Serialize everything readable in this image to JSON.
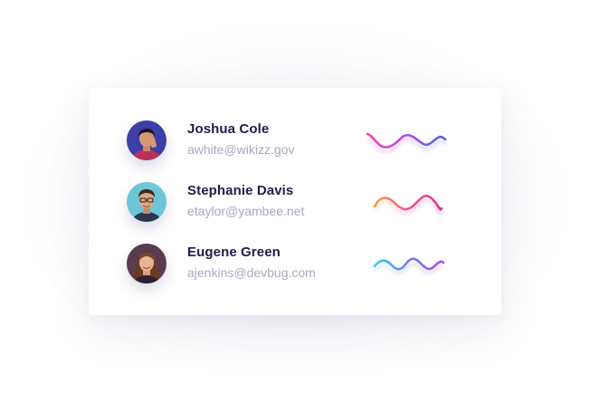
{
  "contacts": [
    {
      "name": "Joshua Cole",
      "email": "awhite@wikizz.gov",
      "avatar_icon": "person-avatar-icon",
      "avatar_bg": "#3b3fa6",
      "wave_gradient": [
        "#ff3fb4",
        "#b04bf0",
        "#4a63f0"
      ]
    },
    {
      "name": "Stephanie Davis",
      "email": "etaylor@yambee.net",
      "avatar_icon": "person-avatar-icon",
      "avatar_bg": "#6cc6d8",
      "wave_gradient": [
        "#ff9a3c",
        "#ff4f8a",
        "#e0308a"
      ]
    },
    {
      "name": "Eugene Green",
      "email": "ajenkins@devbug.com",
      "avatar_icon": "person-avatar-icon",
      "avatar_bg": "#5a3a4e",
      "wave_gradient": [
        "#3cc8f0",
        "#6a7cf5",
        "#b04bf0"
      ]
    }
  ],
  "colors": {
    "name_text": "#1f1d4a",
    "email_text": "#a8a9bd",
    "card_bg": "#ffffff"
  }
}
